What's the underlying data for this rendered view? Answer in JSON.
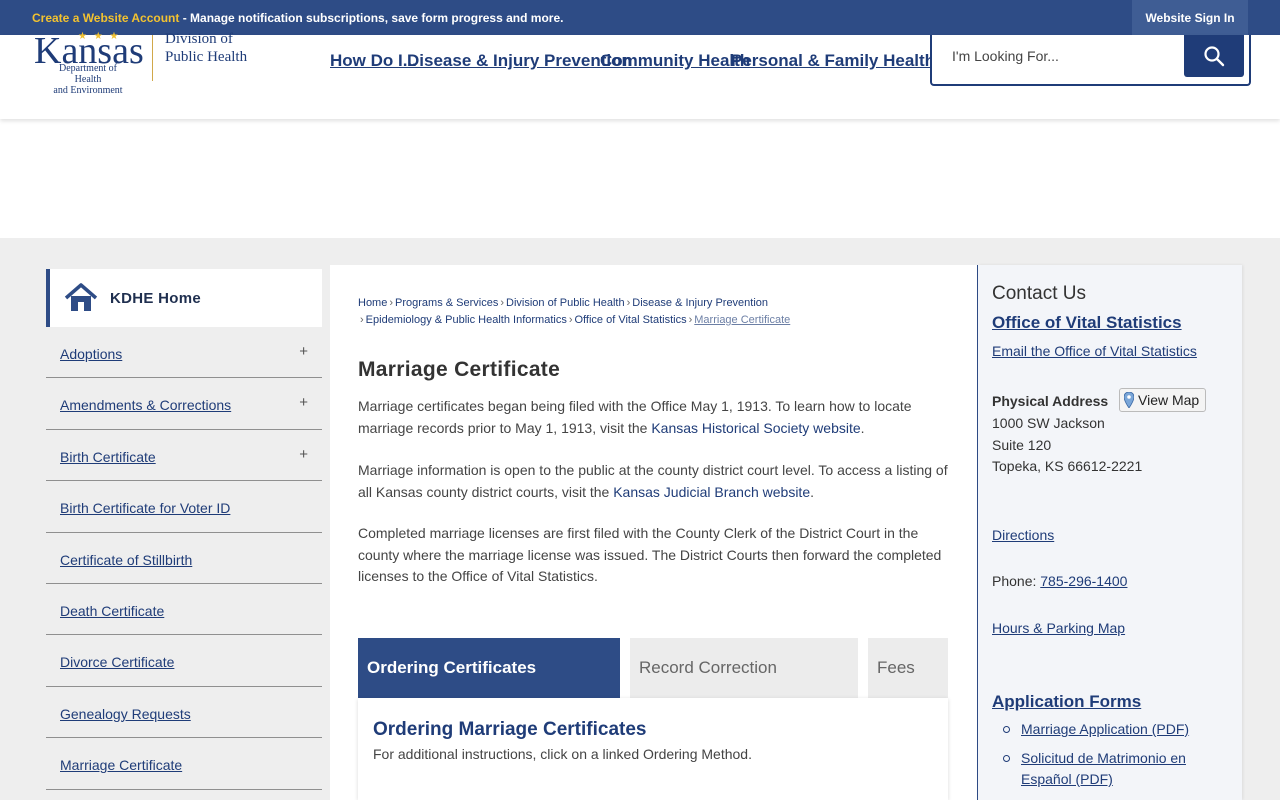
{
  "topbar": {
    "create_account": "Create a Website Account",
    "message": " - Manage notification subscriptions, save form progress and more.",
    "sign_in": "Website Sign In"
  },
  "logo": {
    "kansas": "Kansas",
    "dept_line1": "Department of Health",
    "dept_line2": "and Environment",
    "division_line1": "Division of",
    "division_line2": "Public Health"
  },
  "nav": {
    "items": [
      "How Do I...",
      "Disease & Injury Prevention",
      "Community Health",
      "Personal & Family Health"
    ]
  },
  "search": {
    "placeholder": "I'm Looking For..."
  },
  "sidebar": {
    "home": "KDHE Home",
    "items": [
      {
        "label": "Adoptions",
        "expand": "+"
      },
      {
        "label": "Amendments & Corrections",
        "expand": "+"
      },
      {
        "label": "Birth Certificate",
        "expand": "+"
      },
      {
        "label": "Birth Certificate for Voter ID",
        "expand": ""
      },
      {
        "label": "Certificate of Stillbirth",
        "expand": ""
      },
      {
        "label": "Death Certificate",
        "expand": ""
      },
      {
        "label": "Divorce Certificate",
        "expand": ""
      },
      {
        "label": "Genealogy Requests",
        "expand": ""
      },
      {
        "label": "Marriage Certificate",
        "expand": ""
      }
    ]
  },
  "breadcrumb": {
    "items": [
      "Home",
      "Programs & Services",
      "Division of Public Health",
      "Disease & Injury Prevention",
      "Epidemiology & Public Health Informatics",
      "Office of Vital Statistics"
    ],
    "current": "Marriage Certificate",
    "separator": "›"
  },
  "main": {
    "title": "Marriage Certificate",
    "p1_text": "Marriage certificates began being filed with the Office May 1, 1913. To learn how to locate marriage records prior to May 1, 1913, visit the ",
    "p1_link": "Kansas Historical Society website",
    "p1_end": ".",
    "p2_text": "Marriage information is open to the public at the county district court level. To access a listing of all Kansas county district courts, visit the ",
    "p2_link": "Kansas Judicial Branch website",
    "p2_end": ".",
    "p3_text": "Completed marriage licenses are first filed with the County Clerk of the District Court in the county where the marriage license was issued. The District Courts then forward the completed licenses to the Office of Vital Statistics.",
    "tabs": [
      "Ordering Certificates",
      "Record Correction",
      "Fees"
    ],
    "panel_title": "Ordering Marriage Certificates",
    "panel_text": "For additional instructions, click on a linked Ordering Method."
  },
  "contact": {
    "heading": "Contact Us",
    "office": "Office of Vital Statistics",
    "email": "Email the Office of Vital Statistics",
    "address_label": "Physical Address",
    "view_map": "View Map",
    "address1": "1000 SW Jackson",
    "address2": "Suite 120",
    "address3": "Topeka, KS 66612-2221",
    "directions": "Directions",
    "phone_label": "Phone: ",
    "phone": "785-296-1400",
    "hours": "Hours & Parking Map",
    "forms_heading": "Application Forms",
    "forms": [
      "Marriage Application (PDF)",
      "Solicitud de Matrimonio en Español (PDF)"
    ]
  },
  "colors": {
    "brand_blue": "#2e4c86",
    "link_blue": "#1f3c78",
    "accent_gold": "#f2c230"
  }
}
